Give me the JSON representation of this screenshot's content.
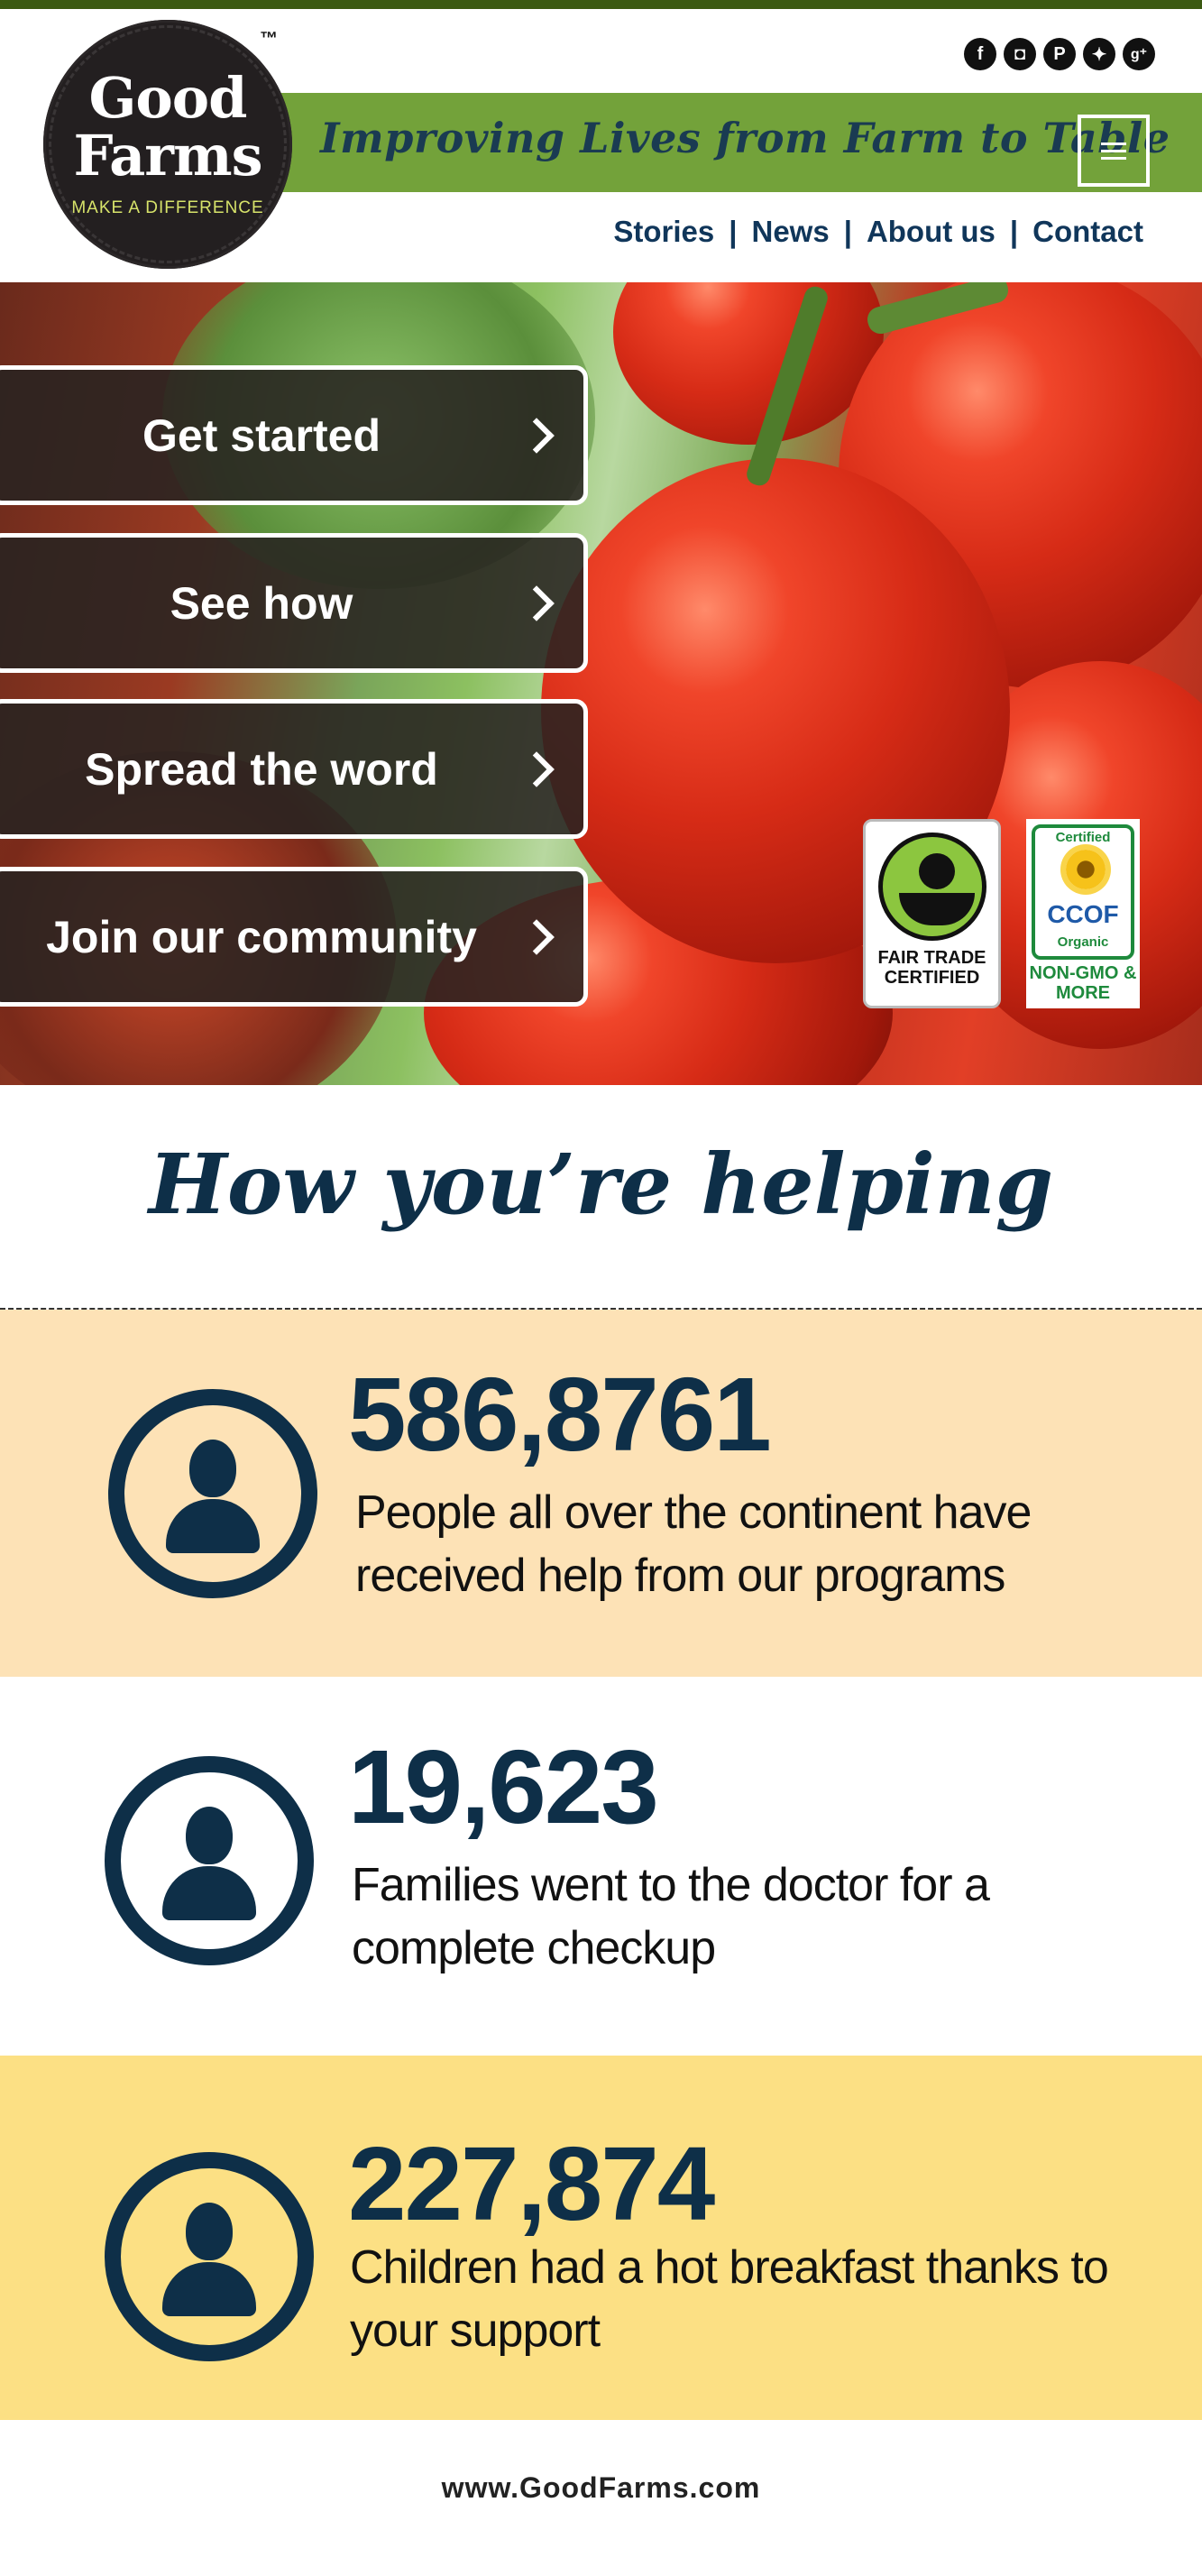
{
  "header": {
    "logo": {
      "line1": "Good",
      "line2": "Farms",
      "tagline": "MAKE A DIFFERENCE",
      "trademark": "™"
    },
    "social": [
      {
        "name": "facebook",
        "glyph": "f"
      },
      {
        "name": "instagram",
        "glyph": "◘"
      },
      {
        "name": "pinterest",
        "glyph": "P"
      },
      {
        "name": "twitter",
        "glyph": "✦"
      },
      {
        "name": "google-plus",
        "glyph": "g⁺"
      }
    ],
    "banner_text": "Improving Lives from Farm to Table",
    "nav": [
      "Stories",
      "News",
      "About us",
      "Contact"
    ],
    "separator": "|"
  },
  "hero": {
    "buttons": [
      "Get started",
      "See how",
      "Spread the word",
      "Join our community"
    ],
    "badges": {
      "fair_trade": "FAIR TRADE CERTIFIED",
      "ccof": {
        "top": "Certified",
        "word": "CCOF",
        "sub": "Organic",
        "bottom": "NON-GMO & MORE"
      }
    }
  },
  "helping": {
    "title": "How you’re helping",
    "stats": [
      {
        "number": "586,8761",
        "text": "People all over the continent have received help from our programs"
      },
      {
        "number": "19,623",
        "text": "Families went to the doctor for a complete checkup"
      },
      {
        "number": "227,874",
        "text": "Children had a hot breakfast thanks to your support"
      }
    ]
  },
  "footer": {
    "url": "www.GoodFarms.com"
  },
  "colors": {
    "green": "#73a23a",
    "navy": "#0e2f48",
    "peach": "#fde2b6",
    "yellow": "#fce084"
  }
}
